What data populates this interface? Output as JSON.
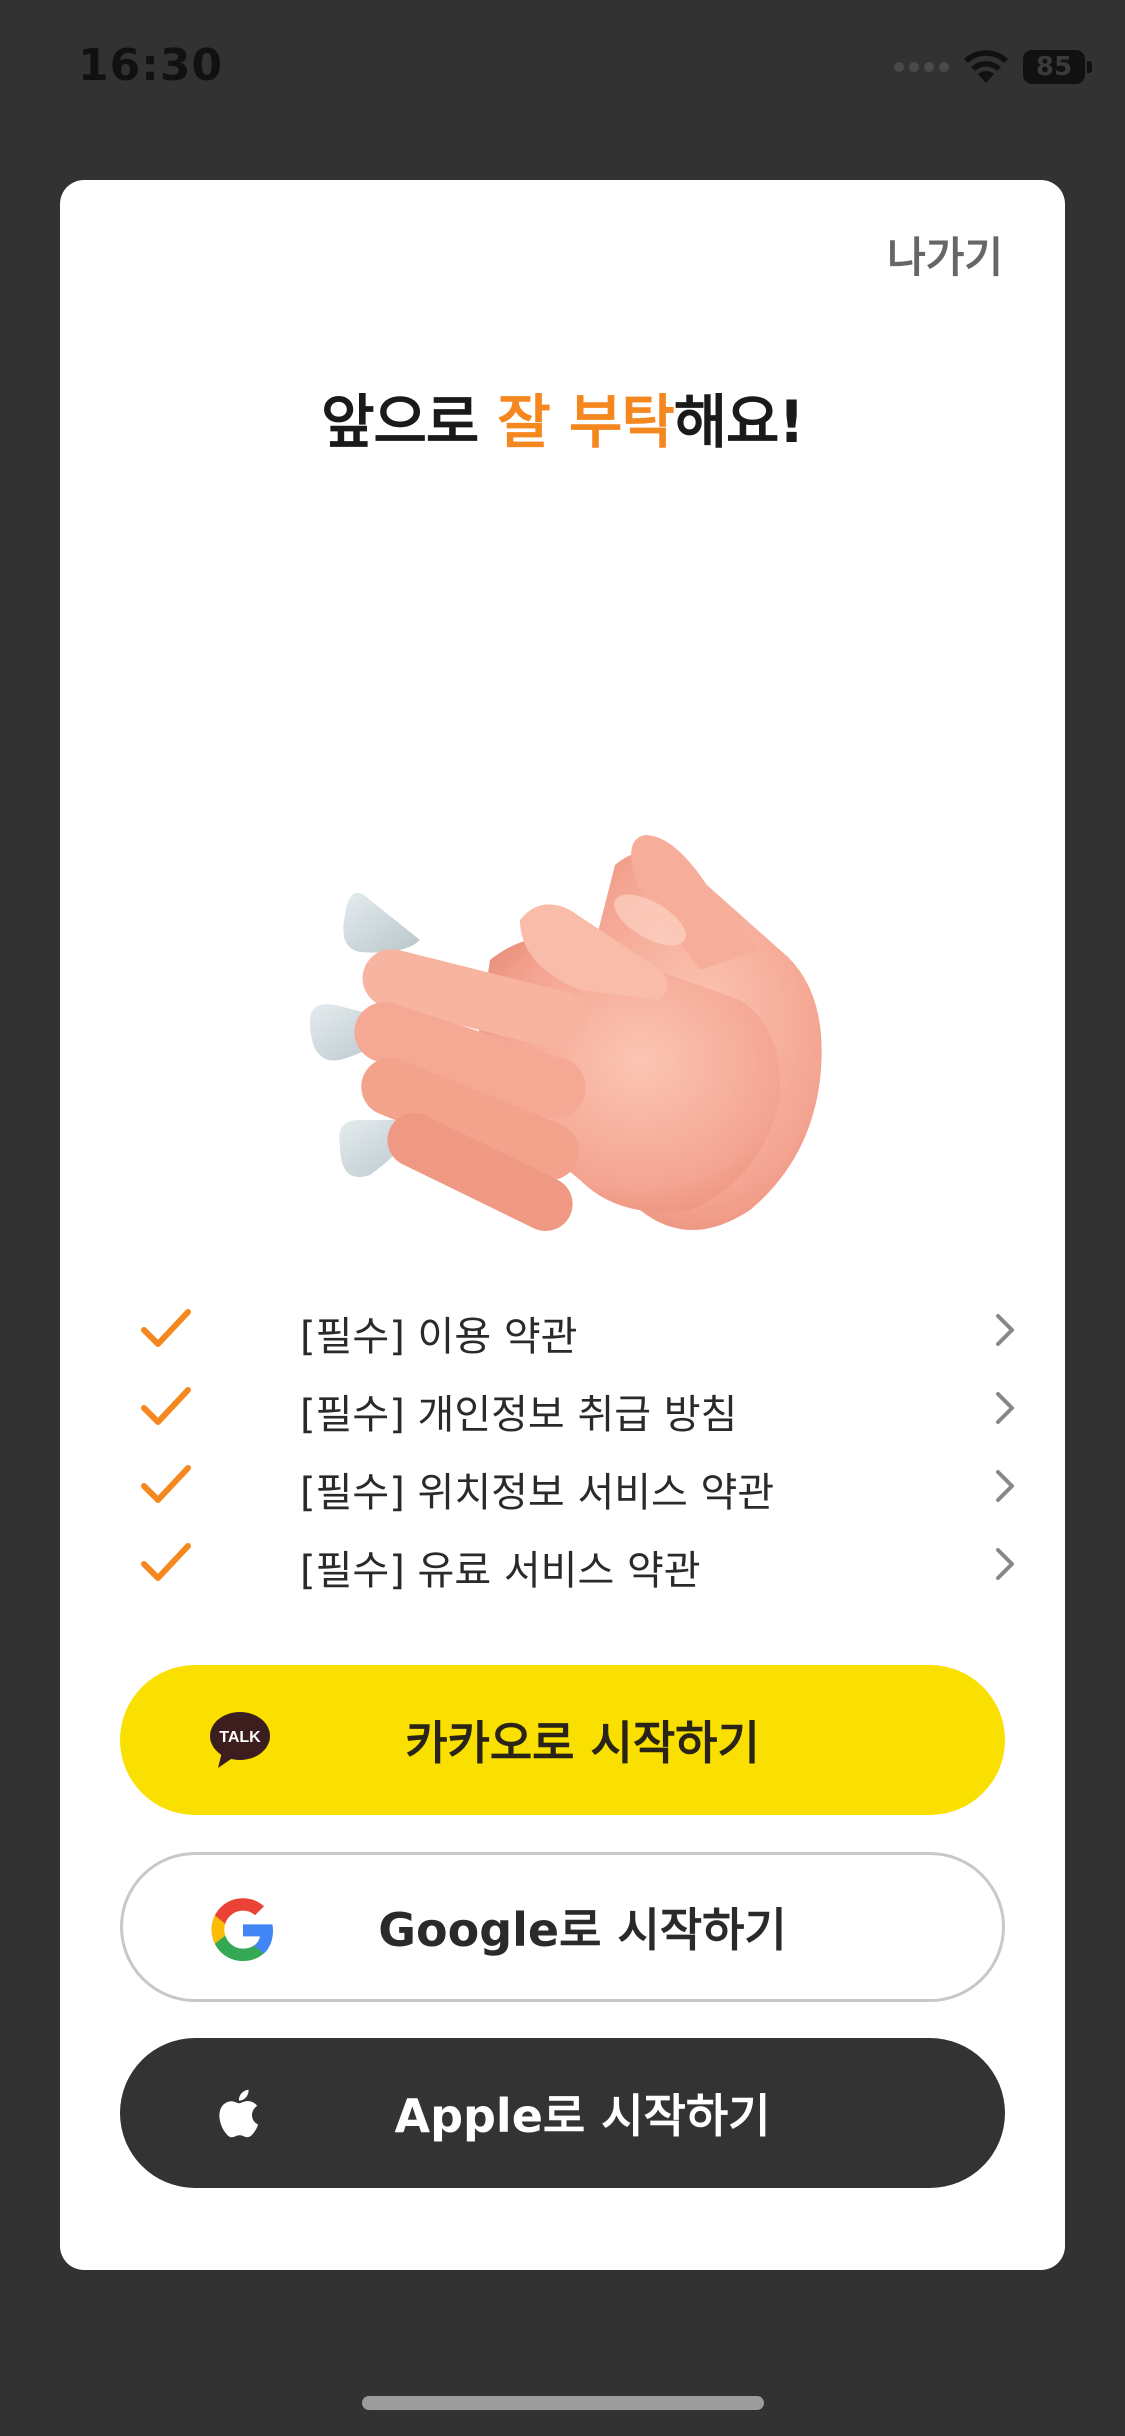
{
  "status_bar": {
    "time": "16:30",
    "battery": "85"
  },
  "modal": {
    "exit_label": "나가기",
    "title_prefix": "앞으로 ",
    "title_accent": "잘 부탁",
    "title_suffix": "해요!"
  },
  "terms": [
    {
      "label": "[필수] 이용 약관"
    },
    {
      "label": "[필수] 개인정보 취급 방침"
    },
    {
      "label": "[필수] 위치정보 서비스 약관"
    },
    {
      "label": "[필수] 유료 서비스 약관"
    }
  ],
  "buttons": {
    "kakao": {
      "label": "카카오로 시작하기",
      "icon_text": "TALK"
    },
    "google": {
      "label": "Google로 시작하기"
    },
    "apple": {
      "label": "Apple로 시작하기"
    }
  },
  "colors": {
    "accent": "#f5871f",
    "kakao_yellow": "#f9e000",
    "apple_dark": "#333333",
    "background": "#323232"
  },
  "icons": {
    "illustration": "clapping-hands",
    "check": "check-icon",
    "chevron": "chevron-right-icon"
  }
}
